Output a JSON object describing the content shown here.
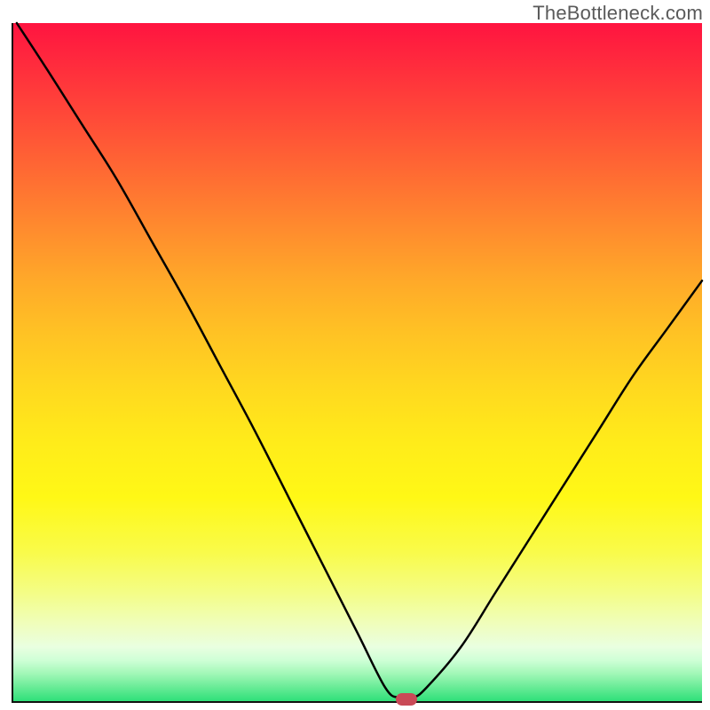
{
  "watermark": "TheBottleneck.com",
  "colors": {
    "axis": "#10110f",
    "curve": "#000000",
    "marker": "#c94a57"
  },
  "chart_data": {
    "type": "line",
    "title": "",
    "xlabel": "",
    "ylabel": "",
    "xlim": [
      0,
      100
    ],
    "ylim": [
      0,
      100
    ],
    "grid": false,
    "legend": false,
    "x": [
      0.5,
      5,
      10,
      15,
      20,
      25,
      30,
      35,
      40,
      45,
      50,
      54,
      56,
      58,
      60,
      65,
      70,
      75,
      80,
      85,
      90,
      95,
      100
    ],
    "values": [
      100,
      93,
      85,
      77,
      68,
      59,
      49.5,
      40,
      30,
      20,
      10,
      2,
      0.5,
      0.5,
      2,
      8,
      16,
      24,
      32,
      40,
      48,
      55,
      62
    ],
    "marker": {
      "x": 57,
      "y": 0.5
    },
    "gradient_stops": [
      {
        "pos": 0.0,
        "color": "#ff1440"
      },
      {
        "pos": 0.14,
        "color": "#ff4a38"
      },
      {
        "pos": 0.3,
        "color": "#ff8a2e"
      },
      {
        "pos": 0.46,
        "color": "#ffc324"
      },
      {
        "pos": 0.62,
        "color": "#ffec1a"
      },
      {
        "pos": 0.78,
        "color": "#f9fb4a"
      },
      {
        "pos": 0.89,
        "color": "#effec0"
      },
      {
        "pos": 0.96,
        "color": "#a0f7b6"
      },
      {
        "pos": 1.0,
        "color": "#2fe079"
      }
    ]
  }
}
